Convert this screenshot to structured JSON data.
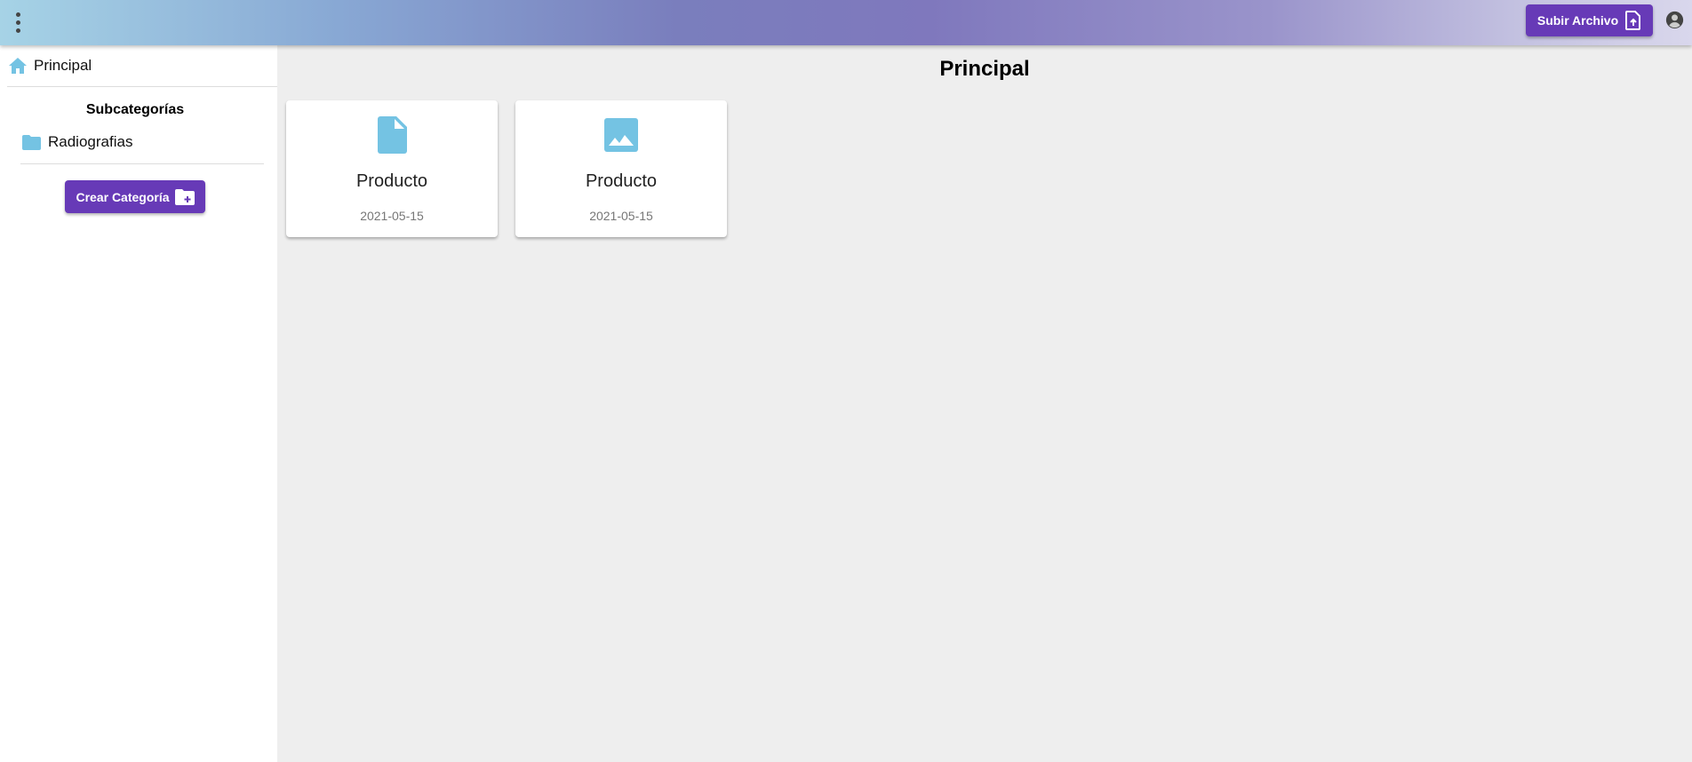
{
  "header": {
    "upload_label": "Subir Archivo",
    "colors": {
      "accent": "#673ab7",
      "icon": "#74c3e3"
    }
  },
  "sidebar": {
    "home_label": "Principal",
    "subcategories_title": "Subcategorías",
    "folders": [
      {
        "label": "Radiografias"
      }
    ],
    "create_label": "Crear Categoría"
  },
  "main": {
    "title": "Principal",
    "cards": [
      {
        "name": "Producto",
        "date": "2021-05-15",
        "icon": "file-icon"
      },
      {
        "name": "Producto",
        "date": "2021-05-15",
        "icon": "image-icon"
      }
    ]
  }
}
